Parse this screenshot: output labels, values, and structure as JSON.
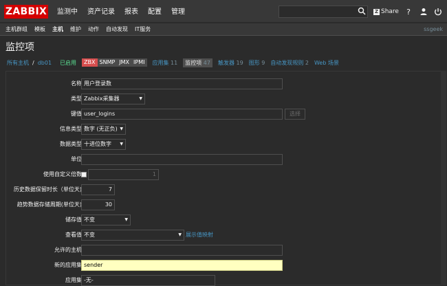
{
  "header": {
    "logo": "ZABBIX",
    "menu": [
      "监测中",
      "资产记录",
      "报表",
      "配置",
      "管理"
    ],
    "active_menu": "配置",
    "search_placeholder": "",
    "share_label": "Share",
    "help_label": "?",
    "user_icon": "user-icon",
    "logout_icon": "power-icon"
  },
  "submenu": {
    "items": [
      "主机群组",
      "模板",
      "主机",
      "维护",
      "动作",
      "自动发现",
      "IT服务"
    ],
    "active": "主机",
    "user": "ssgeek"
  },
  "page": {
    "title": "监控项"
  },
  "nav": {
    "all_hosts": "所有主机",
    "separator": "/",
    "host": "db01",
    "status": "已启用",
    "tags": [
      "ZBX",
      "SNMP",
      "JMX",
      "IPMI"
    ],
    "links": [
      {
        "label": "应用集",
        "count": "11"
      },
      {
        "label": "监控项",
        "count": "47"
      },
      {
        "label": "触发器",
        "count": "19"
      },
      {
        "label": "图形",
        "count": "9"
      },
      {
        "label": "自动发现规则",
        "count": "2"
      },
      {
        "label": "Web 场景",
        "count": ""
      }
    ]
  },
  "form": {
    "name": {
      "label": "名称",
      "value": "用户登录数"
    },
    "type": {
      "label": "类型",
      "value": "Zabbix采集器"
    },
    "key": {
      "label": "键值",
      "value": "user_logins",
      "button": "选择"
    },
    "info_type": {
      "label": "信息类型",
      "value": "数字 (无正负)"
    },
    "data_type": {
      "label": "数据类型",
      "value": "十进位数字"
    },
    "units": {
      "label": "单位",
      "value": ""
    },
    "multiplier": {
      "label": "使用自定义倍数",
      "value": "1"
    },
    "history": {
      "label": "历史数据保留时长（单位天)",
      "value": "7"
    },
    "trends": {
      "label": "趋势数据存储周期(单位天)",
      "value": "30"
    },
    "store": {
      "label": "储存值",
      "value": "不变"
    },
    "show": {
      "label": "查看值",
      "value": "不变",
      "link": "展示值映射"
    },
    "allowed_hosts": {
      "label": "允许的主机",
      "value": ""
    },
    "new_app": {
      "label": "新的应用集",
      "value": "sender"
    },
    "apps": {
      "label": "应用集",
      "value": "-无-"
    }
  }
}
